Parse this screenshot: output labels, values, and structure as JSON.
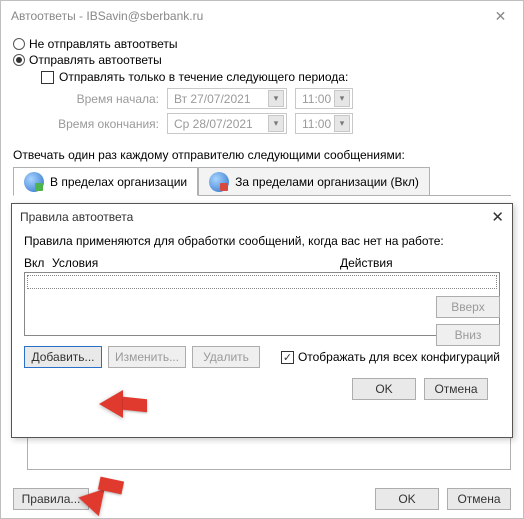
{
  "window": {
    "title": "Автоответы - IBSavin@sberbank.ru"
  },
  "radios": {
    "no_send": "Не отправлять автоответы",
    "send": "Отправлять автоответы"
  },
  "period": {
    "checkbox_label": "Отправлять только в течение следующего периода:",
    "start_label": "Время начала:",
    "end_label": "Время окончания:",
    "start_date": "Вт 27/07/2021",
    "end_date": "Ср 28/07/2021",
    "start_time": "11:00",
    "end_time": "11:00"
  },
  "reply_text": "Отвечать один раз каждому отправителю следующими сообщениями:",
  "tabs": {
    "inside": "В пределах организации",
    "outside": "За пределами организации (Вкл)"
  },
  "dialog": {
    "title": "Правила автоответа",
    "desc": "Правила применяются для обработки сообщений, когда вас нет на работе:",
    "col_on": "Вкл",
    "col_cond": "Условия",
    "col_act": "Действия",
    "btn_up": "Вверх",
    "btn_down": "Вниз",
    "btn_add": "Добавить...",
    "btn_edit": "Изменить...",
    "btn_del": "Удалить",
    "show_all": "Отображать для всех конфигураций",
    "ok": "OK",
    "cancel": "Отмена"
  },
  "footer": {
    "rules": "Правила...",
    "ok": "OK",
    "cancel": "Отмена"
  }
}
